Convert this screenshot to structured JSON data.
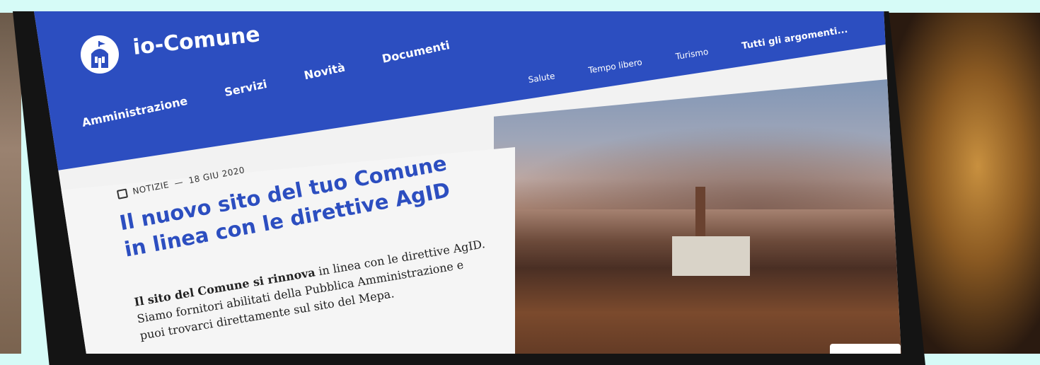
{
  "site": {
    "brand": "io-Comune"
  },
  "main_nav": [
    {
      "label": "Amministrazione"
    },
    {
      "label": "Servizi"
    },
    {
      "label": "Novità"
    },
    {
      "label": "Documenti"
    }
  ],
  "topics": [
    {
      "label": "Salute"
    },
    {
      "label": "Tempo libero"
    },
    {
      "label": "Turismo"
    },
    {
      "label": "Tutti gli argomenti..."
    }
  ],
  "article": {
    "category": "NOTIZIE",
    "separator": "—",
    "date": "18 GIU 2020",
    "title_line1": "Il nuovo sito del tuo Comune",
    "title_line2": "in linea con le direttive AgID",
    "lead_bold": "Il sito del Comune si rinnova",
    "lead_rest": " in linea con le direttive AgID.",
    "lead_line2": "Siamo fornitori abilitati della Pubblica Amministrazione e",
    "lead_line3": "puoi trovarci direttamente sul sito del Mepa."
  },
  "colors": {
    "primary": "#2c4ec0",
    "page_bg": "#d6fbf7"
  }
}
